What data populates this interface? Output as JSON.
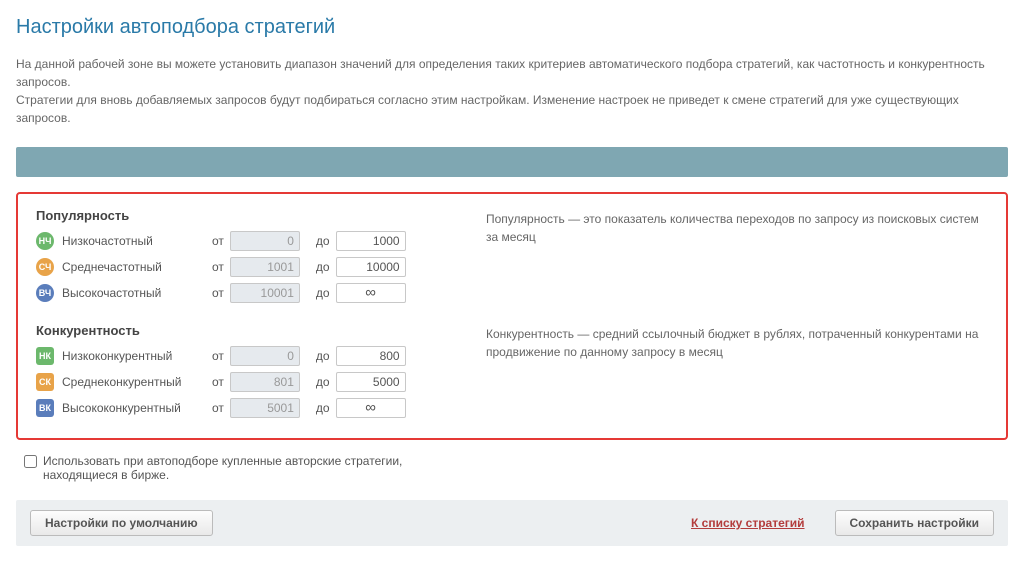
{
  "title": "Настройки автоподбора стратегий",
  "description": {
    "p1": "На данной рабочей зоне вы можете установить диапазон значений для определения таких критериев автоматического подбора стратегий, как частотность и конкурентность запросов.",
    "p2": "Стратегии для вновь добавляемых запросов будут подбираться согласно этим настройкам. Изменение настроек не приведет к смене стратегий для уже существующих запросов."
  },
  "labels": {
    "from": "от",
    "to": "до"
  },
  "popularity": {
    "title": "Популярность",
    "hint": "Популярность — это показатель количества переходов по запросу из поисковых систем за месяц",
    "rows": [
      {
        "badge": "НЧ",
        "label": "Низкочастотный",
        "from": "0",
        "to": "1000"
      },
      {
        "badge": "СЧ",
        "label": "Среднечастотный",
        "from": "1001",
        "to": "10000"
      },
      {
        "badge": "ВЧ",
        "label": "Высокочастотный",
        "from": "10001",
        "to": "∞"
      }
    ]
  },
  "competition": {
    "title": "Конкурентность",
    "hint": "Конкурентность — средний ссылочный бюджет в рублях, потраченный конкурентами на продвижение по данному запросу в месяц",
    "rows": [
      {
        "badge": "НК",
        "label": "Низкоконкурентный",
        "from": "0",
        "to": "800"
      },
      {
        "badge": "СК",
        "label": "Среднеконкурентный",
        "from": "801",
        "to": "5000"
      },
      {
        "badge": "ВК",
        "label": "Высококонкурентный",
        "from": "5001",
        "to": "∞"
      }
    ]
  },
  "checkbox_label": "Использовать при автоподборе купленные авторские стратегии, находящиеся в бирже.",
  "footer": {
    "defaults": "Настройки по умолчанию",
    "list_link": "К списку стратегий",
    "save": "Сохранить настройки"
  }
}
